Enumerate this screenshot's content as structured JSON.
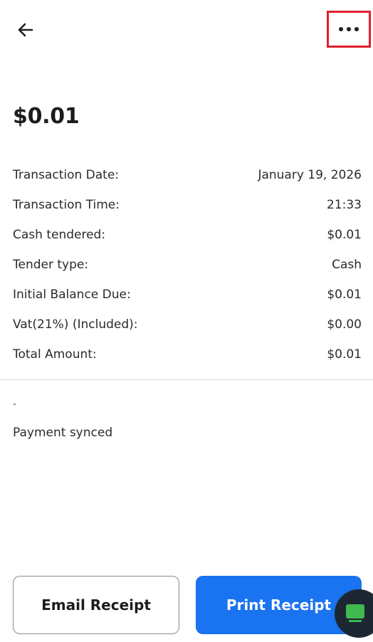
{
  "header": {
    "back_icon": "arrow-left-icon",
    "more_icon": "more-horizontal-icon",
    "highlight_color": "#e01f2d"
  },
  "summary": {
    "amount": "$0.01"
  },
  "details": [
    {
      "label": "Transaction Date:",
      "value": "January 19, 2026"
    },
    {
      "label": "Transaction Time:",
      "value": "21:33"
    },
    {
      "label": "Cash tendered:",
      "value": "$0.01"
    },
    {
      "label": "Tender type:",
      "value": "Cash"
    },
    {
      "label": "Initial Balance Due:",
      "value": "$0.01"
    },
    {
      "label": "Vat(21%) (Included):",
      "value": "$0.00"
    },
    {
      "label": "Total Amount:",
      "value": "$0.01"
    }
  ],
  "notes": {
    "dash": "-",
    "status": "Payment synced"
  },
  "actions": {
    "email_label": "Email Receipt",
    "print_label": "Print Receipt",
    "primary_color": "#1a73f0"
  },
  "chat": {
    "icon": "chat-icon",
    "icon_color": "#3fb950"
  }
}
